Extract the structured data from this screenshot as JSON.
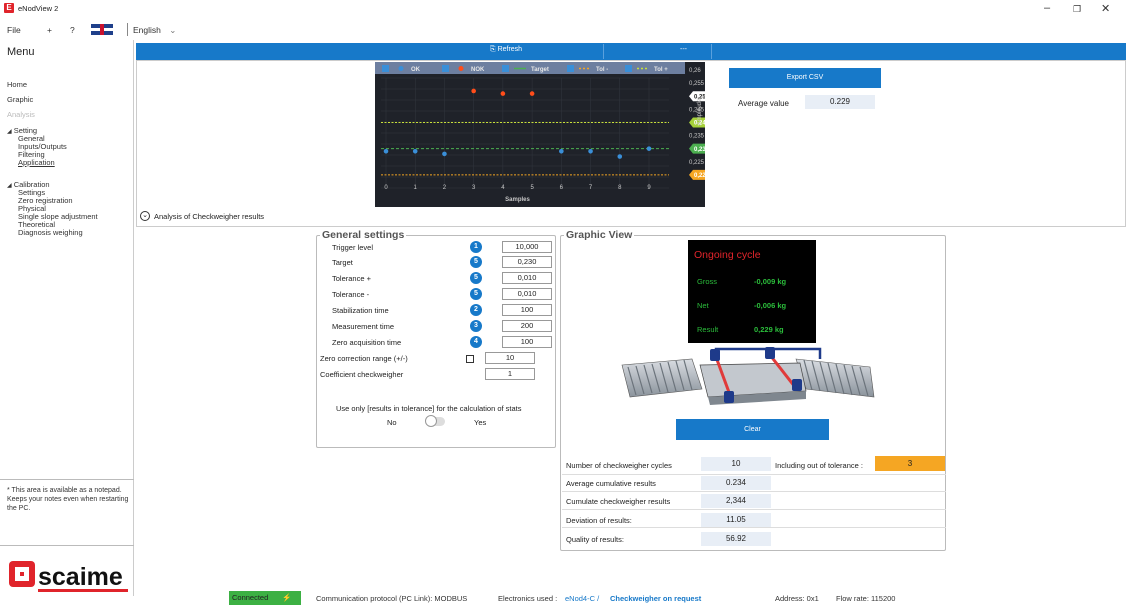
{
  "window": {
    "title": "eNodView 2",
    "icon": "E"
  },
  "menubar": {
    "file": "File",
    "plus": "+",
    "help": "?",
    "language": "English"
  },
  "sidebar": {
    "title": "Menu",
    "home": "Home",
    "graphic": "Graphic",
    "analysis": "Analysis",
    "setting": "Setting",
    "setting_items": [
      "General",
      "Inputs/Outputs",
      "Filtering",
      "Application"
    ],
    "calibration": "Calibration",
    "calibration_items": [
      "Settings",
      "Zero registration",
      "Physical",
      "Single slope adjustment",
      "Theoretical",
      "Diagnosis weighing"
    ],
    "notes": "* This area is available as a notepad. Keeps your notes even when restarting the PC.",
    "logo": "scaime"
  },
  "toolbar": {
    "refresh": "Refresh",
    "status": "---"
  },
  "chart_data": {
    "type": "scatter",
    "legend": [
      "OK",
      "NOK",
      "Target",
      "Tol -",
      "Tol +"
    ],
    "xlabel": "Samples",
    "ylabel": "Amplitude",
    "x": [
      0,
      1,
      2,
      3,
      4,
      5,
      6,
      7,
      8,
      9
    ],
    "ylim": [
      0.215,
      0.26
    ],
    "yticks": [
      "0,26",
      "0,255",
      "0,25",
      "0,245",
      "0,24",
      "0,235",
      "0,23",
      "0,225",
      "0,22"
    ],
    "series": [
      {
        "name": "OK",
        "points": [
          [
            0,
            0.229
          ],
          [
            1,
            0.229
          ],
          [
            2,
            0.228
          ],
          [
            6,
            0.229
          ],
          [
            7,
            0.229
          ],
          [
            8,
            0.227
          ],
          [
            9,
            0.23
          ]
        ]
      },
      {
        "name": "NOK",
        "points": [
          [
            3,
            0.252
          ],
          [
            4,
            0.251
          ],
          [
            5,
            0.251
          ]
        ]
      }
    ],
    "target": 0.23,
    "tol_minus": 0.22,
    "tol_plus": 0.24,
    "badges": [
      {
        "label": "0,25",
        "value": 0.25
      },
      {
        "label": "0,24",
        "value": 0.24
      },
      {
        "label": "0,23",
        "value": 0.23
      },
      {
        "label": "0,22",
        "value": 0.22
      }
    ],
    "colors": {
      "ok": "#3a8fd8",
      "nok": "#ff4d1a",
      "target": "#4caf50",
      "tol_minus": "#f5a623",
      "tol_plus": "#c8e03a",
      "badge_025": "#ffffff",
      "badge_024": "#a6d13a",
      "badge_023": "#4caf50",
      "badge_022": "#f5a623"
    }
  },
  "export": {
    "label": "Export CSV",
    "average_label": "Average value",
    "average_value": "0.229"
  },
  "analysis_label": "Analysis of Checkweigher results",
  "general_settings": {
    "title": "General settings",
    "rows": [
      {
        "label": "Trigger level",
        "badge": "1",
        "value": "10,000"
      },
      {
        "label": "Target",
        "badge": "5",
        "value": "0,230"
      },
      {
        "label": "Tolerance +",
        "badge": "5",
        "value": "0,010"
      },
      {
        "label": "Tolerance -",
        "badge": "5",
        "value": "0,010"
      },
      {
        "label": "Stabilization time",
        "badge": "2",
        "value": "100"
      },
      {
        "label": "Measurement time",
        "badge": "3",
        "value": "200"
      },
      {
        "label": "Zero acquisition time",
        "badge": "4",
        "value": "100"
      }
    ],
    "zero_correction_label": "Zero correction range (+/-)",
    "zero_correction_value": "10",
    "coefficient_label": "Coefficient checkweigher",
    "coefficient_value": "1",
    "use_only": "Use only [results in tolerance] for the calculation of stats",
    "no": "No",
    "yes": "Yes"
  },
  "graphic_view": {
    "title": "Graphic View",
    "cycle_title": "Ongoing cycle",
    "gross_label": "Gross",
    "gross_value": "-0,009 kg",
    "net_label": "Net",
    "net_value": "-0,006 kg",
    "result_label": "Result",
    "result_value": "0,229 kg",
    "clear": "Clear"
  },
  "stats": {
    "cycles_label": "Number of checkweigher cycles",
    "cycles_value": "10",
    "oot_label": "Including out of tolerance :",
    "oot_value": "3",
    "avg_label": "Average cumulative results",
    "avg_value": "0.234",
    "cum_label": "Cumulate checkweigher results",
    "cum_value": "2,344",
    "dev_label": "Deviation of results:",
    "dev_value": "11.05",
    "quality_label": "Quality of results:",
    "quality_value": "56.92"
  },
  "statusbar": {
    "connected": "Connected",
    "protocol": "Communication protocol (PC Link): MODBUS",
    "electronics_label": "Electronics used :",
    "electronics_value": "eNod4-C /",
    "checkweigher": "Checkweigher on request",
    "address": "Address: 0x1",
    "flow": "Flow rate: 115200"
  }
}
